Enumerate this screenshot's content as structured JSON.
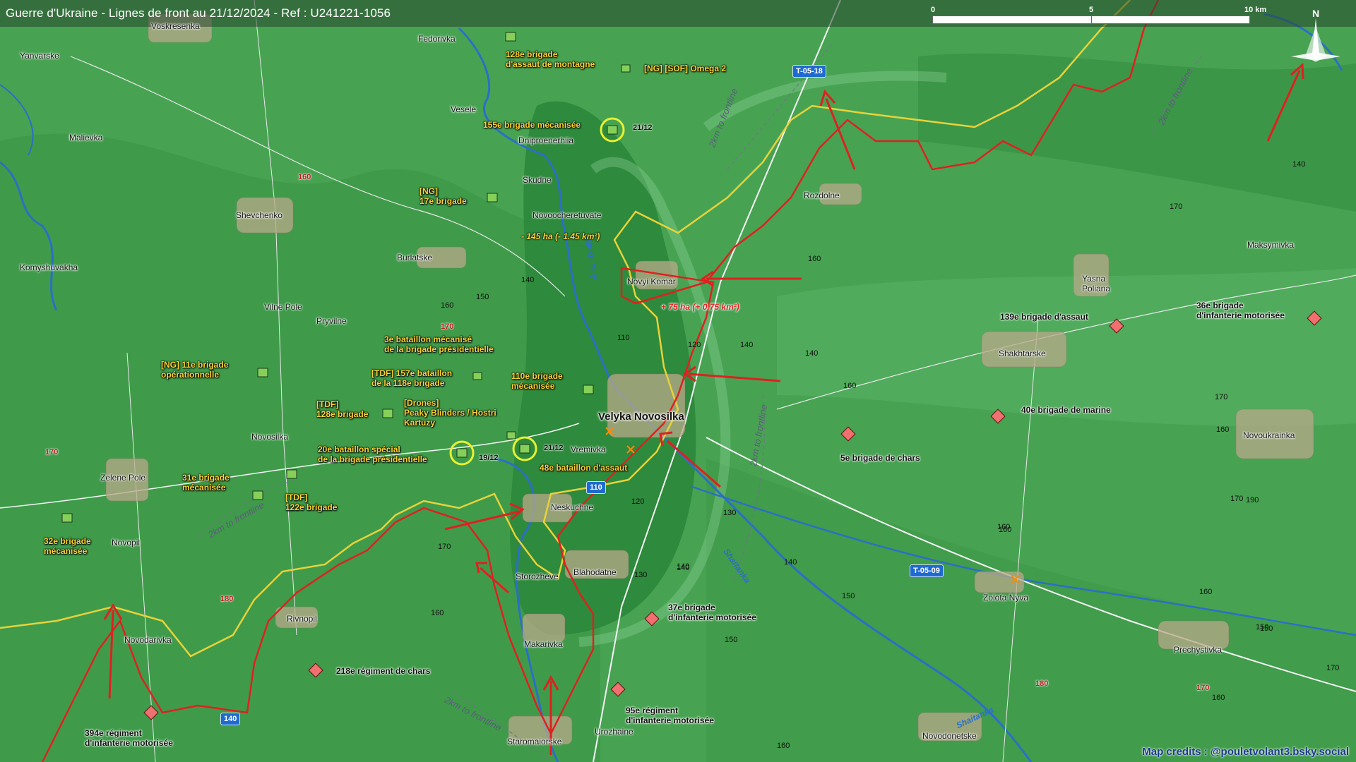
{
  "title": "Guerre d'Ukraine - Lignes de front au 21/12/2024 - Ref : U241221-1056",
  "scale": {
    "ticks": [
      "0",
      "5",
      "10 km"
    ]
  },
  "compass": {
    "label": "N",
    "icon": "compass-rose-icon"
  },
  "credit": "Map credits : @pouletvolant3.bsky.social",
  "colors": {
    "russian": "#e02020",
    "ukrainian_line": "#e8d23a",
    "terrain": "#3f9a4c",
    "water": "#2b6fc6",
    "road_badge": "#1f6ad0"
  },
  "roads": [
    "T-05-18",
    "T-05-09",
    "110",
    "140"
  ],
  "rivers": [
    "Mokri Yaly",
    "Shaitanka",
    "Shaitanka"
  ],
  "frontline_buffer_label": "2km to frontline",
  "territory_change": {
    "gain": "+ 75 ha (+ 0.75 km²)",
    "loss": "- 145 ha (- 1.45 km²)"
  },
  "towns": {
    "velyka": "Velyka Novosilka",
    "list": [
      "Voskresenka",
      "Yanvarske",
      "Fedorivka",
      "Vesele",
      "Malievka",
      "Dniproenerhiia",
      "Skudne",
      "Novoocheretuvate",
      "Shevchenko",
      "Burlatske",
      "Komyshuvakha",
      "Vilne Pole",
      "Pryvilne",
      "Novyi Komar",
      "Rozdolne",
      "Yasna Poliana",
      "Maksymivka",
      "Shakhtarske",
      "Novosilka",
      "Vremivka",
      "Neskuchne",
      "Zelene Pole",
      "Novopil",
      "Storozheve",
      "Blahodatne",
      "Makarivka",
      "Rivnopil",
      "Novodarivka",
      "Staromaiorske",
      "Urozhaine",
      "Zolota Nyva",
      "Prechystivka",
      "Novodonetske",
      "Novoukrainka"
    ]
  },
  "units_ua": {
    "u128": "128e brigade\nd'assaut de montagne",
    "omega": "[NG] [SOF] Omega 2",
    "u155": "155e brigade mécanisée",
    "ng17": "[NG]\n17e brigade",
    "u3bat": "3e bataillon mécanisé\nde la brigade présidentielle",
    "ng11": "[NG] 11e brigade\nopérationnelle",
    "tdf157": "[TDF] 157e bataillon\nde la 118e brigade",
    "u110": "110e brigade\nmécanisée",
    "tdf128": "[TDF]\n128e brigade",
    "drones": "[Drones]\nPeaky Blinders / Hostri\nKartuzy",
    "u20bat": "20e bataillon spécial\nde la brigade présidentielle",
    "u48": "48e bataillon d'assaut",
    "u31": "31e brigade\nmécanisée",
    "tdf122": "[TDF]\n122e brigade",
    "u32": "32e brigade\nmécanisée"
  },
  "units_ru": {
    "u139": "139e brigade d'assaut",
    "u36": "36e brigade\nd'infanterie motorisée",
    "u40": "40e brigade de marine",
    "u5": "5e brigade de chars",
    "u37": "37e brigade\nd'infanterie motorisée",
    "u218": "218e régiment de chars",
    "u95": "95e régiment\nd'infanterie motorisée",
    "u394": "394e régiment\nd'infanterie motorisée"
  },
  "dates": [
    "21/12",
    "19/12",
    "21/12"
  ],
  "elevations": [
    "160",
    "140",
    "150",
    "160",
    "110",
    "120",
    "140",
    "160",
    "170",
    "140",
    "170",
    "160",
    "170",
    "180",
    "160",
    "170",
    "120",
    "130",
    "140",
    "150",
    "160",
    "140",
    "150",
    "130",
    "140",
    "160",
    "150",
    "160",
    "170",
    "190",
    "160",
    "150",
    "160",
    "170",
    "160",
    "170",
    "180",
    "170",
    "140"
  ]
}
